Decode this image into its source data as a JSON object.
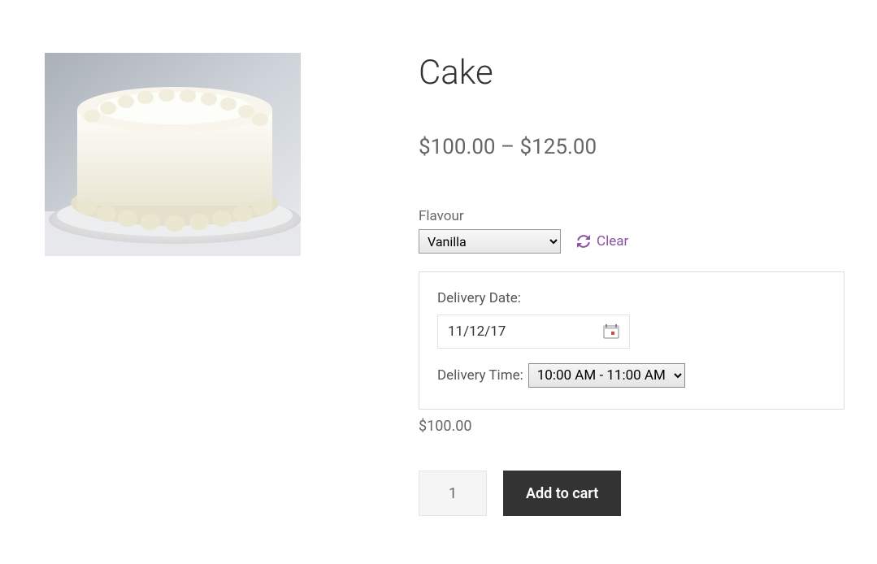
{
  "product": {
    "title": "Cake",
    "price_min_currency": "$",
    "price_min": "100.00",
    "price_sep": " – ",
    "price_max_currency": "$",
    "price_max": "125.00"
  },
  "flavour": {
    "label": "Flavour",
    "selected": "Vanilla",
    "options": [
      "Vanilla"
    ],
    "clear_label": "Clear"
  },
  "delivery": {
    "date_label": "Delivery Date:",
    "date_value": "11/12/17",
    "time_label": "Delivery Time:",
    "time_selected": "10:00 AM - 11:00 AM",
    "time_options": [
      "10:00 AM - 11:00 AM"
    ]
  },
  "subtotal": {
    "currency": "$",
    "value": "100.00"
  },
  "cart": {
    "quantity": "1",
    "add_label": "Add to cart"
  }
}
